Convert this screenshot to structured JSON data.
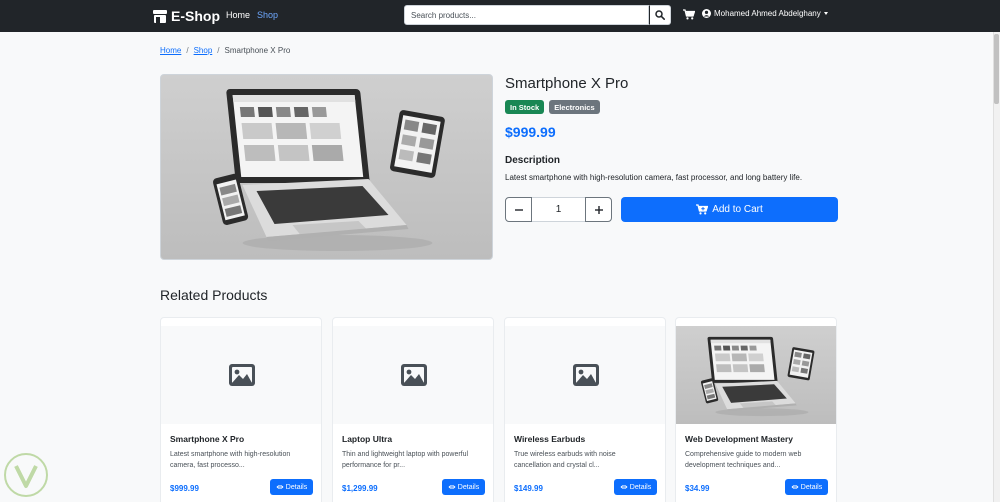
{
  "navbar": {
    "brand": "E-Shop",
    "links": [
      {
        "label": "Home"
      },
      {
        "label": "Shop"
      }
    ],
    "search_placeholder": "Search products...",
    "user_name": "Mohamed Ahmed Abdelghany"
  },
  "breadcrumb": {
    "home": "Home",
    "shop": "Shop",
    "current": "Smartphone X Pro"
  },
  "product": {
    "title": "Smartphone X Pro",
    "stock_badge": "In Stock",
    "category_badge": "Electronics",
    "price": "$999.99",
    "description_heading": "Description",
    "description": "Latest smartphone with high-resolution camera, fast processor, and long battery life.",
    "quantity": "1",
    "add_to_cart_label": "Add to Cart"
  },
  "related": {
    "title": "Related Products",
    "details_label": "Details",
    "items": [
      {
        "title": "Smartphone X Pro",
        "desc_1": "Latest smartphone with high-resolution",
        "desc_2": "camera, fast processo...",
        "price": "$999.99"
      },
      {
        "title": "Laptop Ultra",
        "desc_1": "Thin and lightweight laptop with powerful",
        "desc_2": "performance for pr...",
        "price": "$1,299.99"
      },
      {
        "title": "Wireless Earbuds",
        "desc_1": "True wireless earbuds with noise",
        "desc_2": "cancellation and crystal cl...",
        "price": "$149.99"
      },
      {
        "title": "Web Development Mastery",
        "desc_1": "Comprehensive guide to modern web",
        "desc_2": "development techniques and...",
        "price": "$34.99"
      }
    ]
  },
  "colors": {
    "primary": "#0d6efd",
    "navbar": "#212529",
    "success": "#198754",
    "secondary": "#6c757d"
  },
  "icons": [
    "store-icon",
    "search-icon",
    "cart-icon",
    "user-circle-icon",
    "minus-icon",
    "plus-icon",
    "image-placeholder-icon",
    "eye-icon"
  ]
}
